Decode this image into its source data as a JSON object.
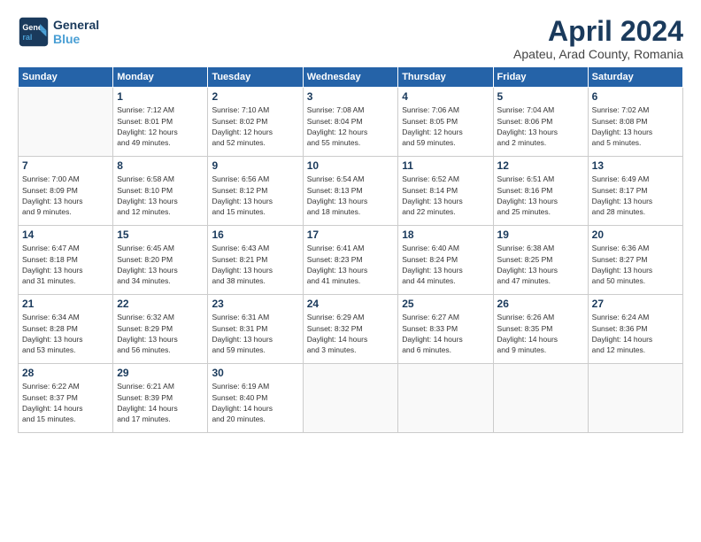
{
  "header": {
    "logo_general": "General",
    "logo_blue": "Blue",
    "month_title": "April 2024",
    "location": "Apateu, Arad County, Romania"
  },
  "weekdays": [
    "Sunday",
    "Monday",
    "Tuesday",
    "Wednesday",
    "Thursday",
    "Friday",
    "Saturday"
  ],
  "weeks": [
    [
      {
        "day": "",
        "info": ""
      },
      {
        "day": "1",
        "info": "Sunrise: 7:12 AM\nSunset: 8:01 PM\nDaylight: 12 hours\nand 49 minutes."
      },
      {
        "day": "2",
        "info": "Sunrise: 7:10 AM\nSunset: 8:02 PM\nDaylight: 12 hours\nand 52 minutes."
      },
      {
        "day": "3",
        "info": "Sunrise: 7:08 AM\nSunset: 8:04 PM\nDaylight: 12 hours\nand 55 minutes."
      },
      {
        "day": "4",
        "info": "Sunrise: 7:06 AM\nSunset: 8:05 PM\nDaylight: 12 hours\nand 59 minutes."
      },
      {
        "day": "5",
        "info": "Sunrise: 7:04 AM\nSunset: 8:06 PM\nDaylight: 13 hours\nand 2 minutes."
      },
      {
        "day": "6",
        "info": "Sunrise: 7:02 AM\nSunset: 8:08 PM\nDaylight: 13 hours\nand 5 minutes."
      }
    ],
    [
      {
        "day": "7",
        "info": "Sunrise: 7:00 AM\nSunset: 8:09 PM\nDaylight: 13 hours\nand 9 minutes."
      },
      {
        "day": "8",
        "info": "Sunrise: 6:58 AM\nSunset: 8:10 PM\nDaylight: 13 hours\nand 12 minutes."
      },
      {
        "day": "9",
        "info": "Sunrise: 6:56 AM\nSunset: 8:12 PM\nDaylight: 13 hours\nand 15 minutes."
      },
      {
        "day": "10",
        "info": "Sunrise: 6:54 AM\nSunset: 8:13 PM\nDaylight: 13 hours\nand 18 minutes."
      },
      {
        "day": "11",
        "info": "Sunrise: 6:52 AM\nSunset: 8:14 PM\nDaylight: 13 hours\nand 22 minutes."
      },
      {
        "day": "12",
        "info": "Sunrise: 6:51 AM\nSunset: 8:16 PM\nDaylight: 13 hours\nand 25 minutes."
      },
      {
        "day": "13",
        "info": "Sunrise: 6:49 AM\nSunset: 8:17 PM\nDaylight: 13 hours\nand 28 minutes."
      }
    ],
    [
      {
        "day": "14",
        "info": "Sunrise: 6:47 AM\nSunset: 8:18 PM\nDaylight: 13 hours\nand 31 minutes."
      },
      {
        "day": "15",
        "info": "Sunrise: 6:45 AM\nSunset: 8:20 PM\nDaylight: 13 hours\nand 34 minutes."
      },
      {
        "day": "16",
        "info": "Sunrise: 6:43 AM\nSunset: 8:21 PM\nDaylight: 13 hours\nand 38 minutes."
      },
      {
        "day": "17",
        "info": "Sunrise: 6:41 AM\nSunset: 8:23 PM\nDaylight: 13 hours\nand 41 minutes."
      },
      {
        "day": "18",
        "info": "Sunrise: 6:40 AM\nSunset: 8:24 PM\nDaylight: 13 hours\nand 44 minutes."
      },
      {
        "day": "19",
        "info": "Sunrise: 6:38 AM\nSunset: 8:25 PM\nDaylight: 13 hours\nand 47 minutes."
      },
      {
        "day": "20",
        "info": "Sunrise: 6:36 AM\nSunset: 8:27 PM\nDaylight: 13 hours\nand 50 minutes."
      }
    ],
    [
      {
        "day": "21",
        "info": "Sunrise: 6:34 AM\nSunset: 8:28 PM\nDaylight: 13 hours\nand 53 minutes."
      },
      {
        "day": "22",
        "info": "Sunrise: 6:32 AM\nSunset: 8:29 PM\nDaylight: 13 hours\nand 56 minutes."
      },
      {
        "day": "23",
        "info": "Sunrise: 6:31 AM\nSunset: 8:31 PM\nDaylight: 13 hours\nand 59 minutes."
      },
      {
        "day": "24",
        "info": "Sunrise: 6:29 AM\nSunset: 8:32 PM\nDaylight: 14 hours\nand 3 minutes."
      },
      {
        "day": "25",
        "info": "Sunrise: 6:27 AM\nSunset: 8:33 PM\nDaylight: 14 hours\nand 6 minutes."
      },
      {
        "day": "26",
        "info": "Sunrise: 6:26 AM\nSunset: 8:35 PM\nDaylight: 14 hours\nand 9 minutes."
      },
      {
        "day": "27",
        "info": "Sunrise: 6:24 AM\nSunset: 8:36 PM\nDaylight: 14 hours\nand 12 minutes."
      }
    ],
    [
      {
        "day": "28",
        "info": "Sunrise: 6:22 AM\nSunset: 8:37 PM\nDaylight: 14 hours\nand 15 minutes."
      },
      {
        "day": "29",
        "info": "Sunrise: 6:21 AM\nSunset: 8:39 PM\nDaylight: 14 hours\nand 17 minutes."
      },
      {
        "day": "30",
        "info": "Sunrise: 6:19 AM\nSunset: 8:40 PM\nDaylight: 14 hours\nand 20 minutes."
      },
      {
        "day": "",
        "info": ""
      },
      {
        "day": "",
        "info": ""
      },
      {
        "day": "",
        "info": ""
      },
      {
        "day": "",
        "info": ""
      }
    ]
  ]
}
